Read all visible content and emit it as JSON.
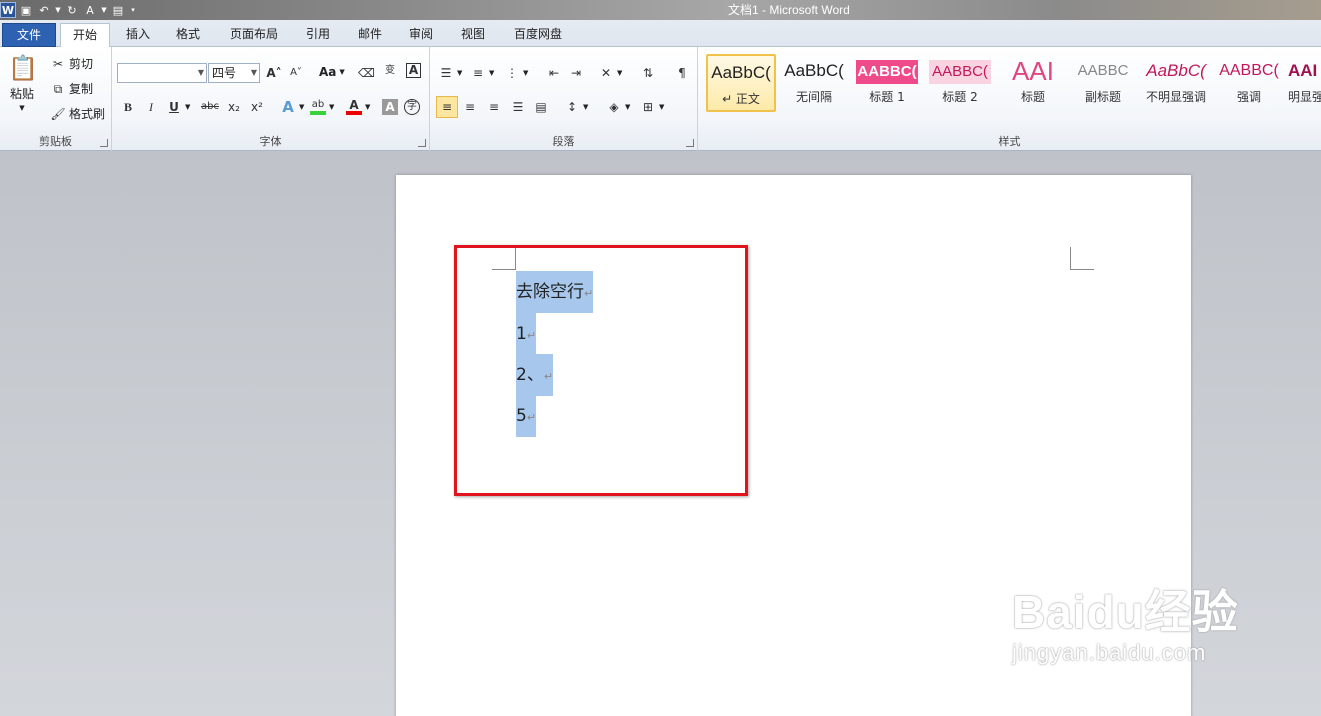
{
  "window": {
    "title": "文档1 - Microsoft Word",
    "app_icon": "W"
  },
  "tabs": [
    "文件",
    "开始",
    "插入",
    "格式",
    "页面布局",
    "引用",
    "邮件",
    "审阅",
    "视图",
    "百度网盘"
  ],
  "ribbon": {
    "clipboard": {
      "label": "剪贴板",
      "paste": "粘贴",
      "cut": "剪切",
      "copy": "复制",
      "format_painter": "格式刷"
    },
    "font": {
      "label": "字体",
      "font_name": "",
      "font_size": "四号",
      "case_label": "Aa"
    },
    "paragraph": {
      "label": "段落"
    },
    "styles": {
      "label": "样式",
      "items": [
        {
          "sample": "AaBbC(",
          "name": "↵ 正文"
        },
        {
          "sample": "AaBbC(",
          "name": "无间隔"
        },
        {
          "sample": "AABBC(",
          "name": "标题 1"
        },
        {
          "sample": "AABBC(",
          "name": "标题 2"
        },
        {
          "sample": "AAI",
          "name": "标题"
        },
        {
          "sample": "AABBC",
          "name": "副标题"
        },
        {
          "sample": "AaBbC(",
          "name": "不明显强调"
        },
        {
          "sample": "AABBC(",
          "name": "强调"
        },
        {
          "sample": "AAI",
          "name": "明显强"
        }
      ]
    }
  },
  "document": {
    "lines": [
      {
        "text": "去除空行",
        "mark": "↵"
      },
      {
        "text": "1",
        "mark": "↵"
      },
      {
        "text": "2、",
        "mark": "↵"
      },
      {
        "text": "5",
        "mark": "↵"
      }
    ]
  },
  "watermark": {
    "main": "Baidu经验",
    "sub": "jingyan.baidu.com"
  },
  "colors": {
    "selection": "#a7c8ec",
    "highlight_box": "#e0141c",
    "file_tab": "#2d62b3"
  }
}
